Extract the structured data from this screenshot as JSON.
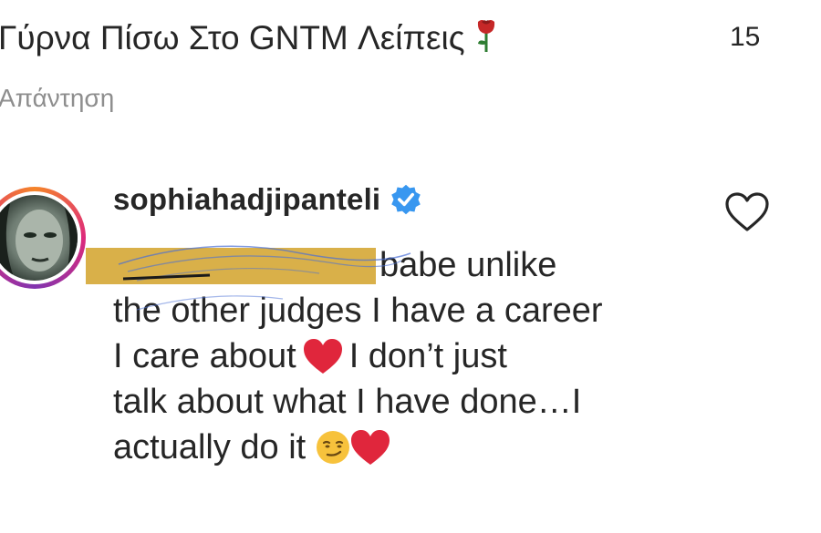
{
  "top_comment": {
    "text": "Γύρνα Πίσω Στο GNTM Λείπεις",
    "emoji_icon": "rose-icon",
    "like_count": "15",
    "reply_label": "Απάντηση"
  },
  "comment": {
    "username": "sophiahadjipanteli",
    "verified_icon": "verified-badge-icon",
    "like_icon": "heart-outline-icon",
    "line1": "babe unlike",
    "line2": "the other judges I have a career",
    "line3a": "I care about",
    "line3b": "I don’t just",
    "line4": "talk about what I have done…I",
    "line5": "actually do it",
    "emojis": [
      "red-heart-icon",
      "smirking-face-icon",
      "red-heart-icon"
    ]
  },
  "colors": {
    "text": "#262626",
    "secondary_text": "#8e8e8e",
    "verified_blue": "#3897f0",
    "redaction_yellow": "#d6a93a",
    "heart_red": "#e0263c"
  }
}
